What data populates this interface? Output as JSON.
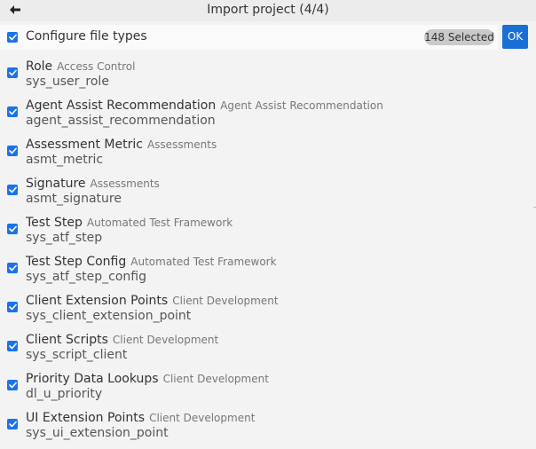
{
  "header": {
    "title": "Import project (4/4)",
    "back_icon": "arrow-left-icon"
  },
  "filter": {
    "label": "Configure file types",
    "checked": true,
    "selected_badge": "148 Selected",
    "ok_label": "OK"
  },
  "colors": {
    "accent": "#1a73e8",
    "ok_button": "#1a6fd6",
    "badge": "#c9c9c9",
    "background": "#f3f3f3"
  },
  "items": [
    {
      "name": "Role",
      "category": "Access Control",
      "table": "sys_user_role",
      "checked": true
    },
    {
      "name": "Agent Assist Recommendation",
      "category": "Agent Assist Recommendation",
      "table": "agent_assist_recommendation",
      "checked": true
    },
    {
      "name": "Assessment Metric",
      "category": "Assessments",
      "table": "asmt_metric",
      "checked": true
    },
    {
      "name": "Signature",
      "category": "Assessments",
      "table": "asmt_signature",
      "checked": true
    },
    {
      "name": "Test Step",
      "category": "Automated Test Framework",
      "table": "sys_atf_step",
      "checked": true
    },
    {
      "name": "Test Step Config",
      "category": "Automated Test Framework",
      "table": "sys_atf_step_config",
      "checked": true
    },
    {
      "name": "Client Extension Points",
      "category": "Client Development",
      "table": "sys_client_extension_point",
      "checked": true
    },
    {
      "name": "Client Scripts",
      "category": "Client Development",
      "table": "sys_script_client",
      "checked": true
    },
    {
      "name": "Priority Data Lookups",
      "category": "Client Development",
      "table": "dl_u_priority",
      "checked": true
    },
    {
      "name": "UI Extension Points",
      "category": "Client Development",
      "table": "sys_ui_extension_point",
      "checked": true
    }
  ]
}
